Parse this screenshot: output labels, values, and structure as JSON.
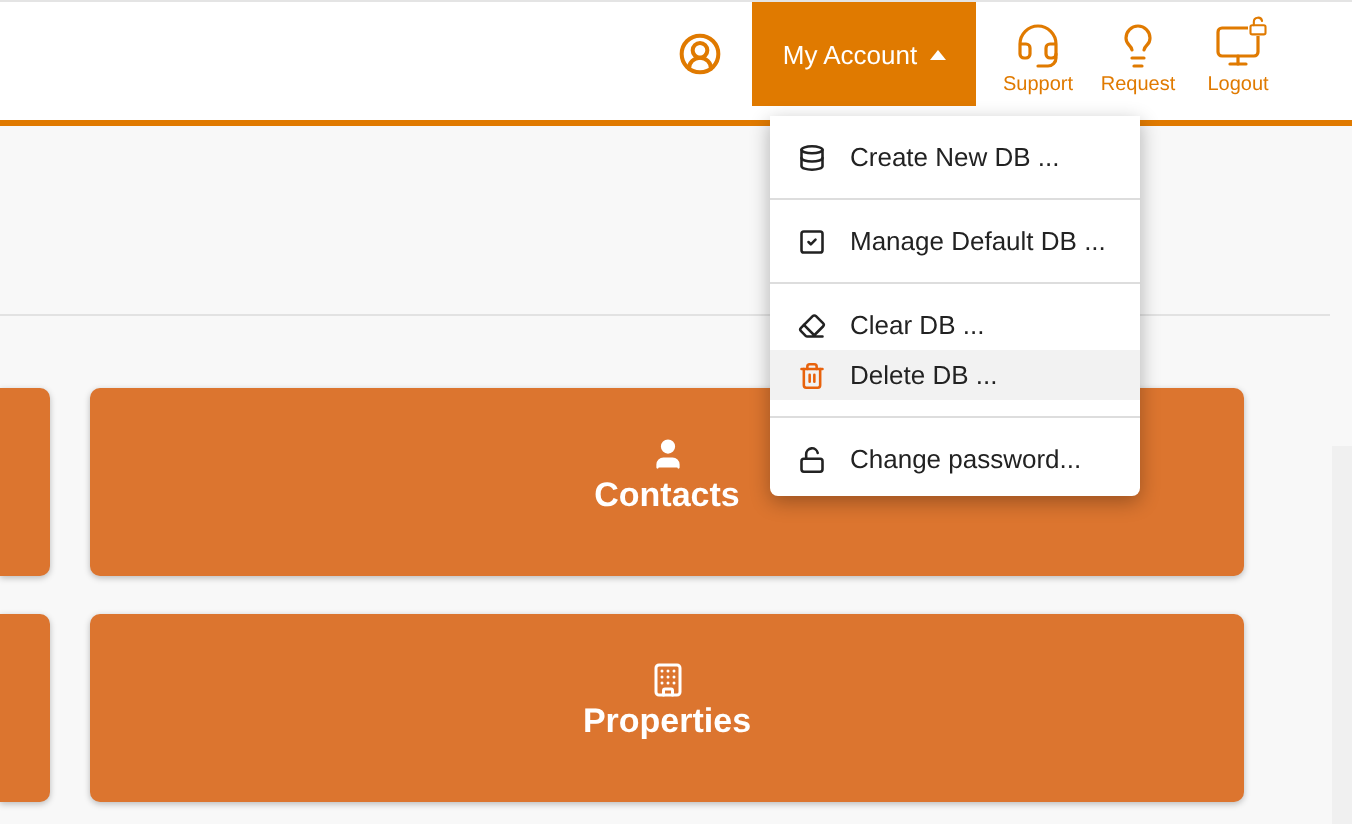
{
  "header": {
    "account_button": {
      "label": "My Account",
      "expanded": true
    },
    "actions": [
      {
        "label": "Support"
      },
      {
        "label": "Request"
      },
      {
        "label": "Logout"
      }
    ]
  },
  "menu": {
    "groups": [
      [
        {
          "label": "Create New DB ...",
          "selected": false
        }
      ],
      [
        {
          "label": "Manage Default DB ...",
          "selected": false
        }
      ],
      [
        {
          "label": "Clear DB ...",
          "selected": false
        },
        {
          "label": "Delete DB ...",
          "selected": true
        }
      ],
      [
        {
          "label": "Change password...",
          "selected": false
        }
      ]
    ]
  },
  "tiles": [
    {
      "label": "Contacts"
    },
    {
      "label": "Properties"
    }
  ]
}
